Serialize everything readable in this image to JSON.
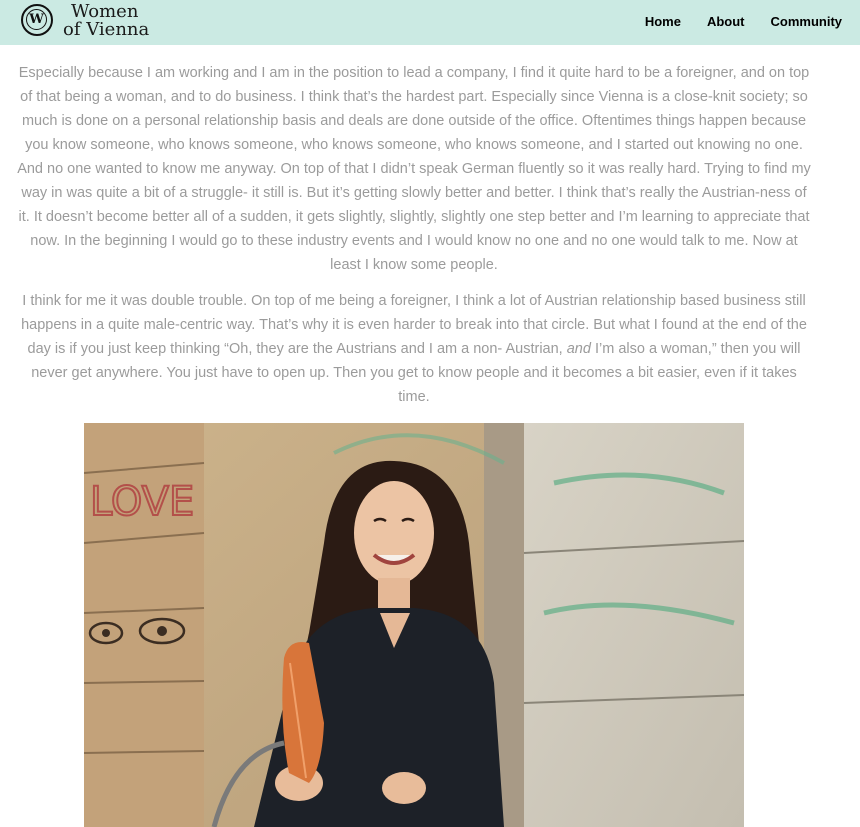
{
  "header": {
    "logo_letter": "W",
    "brand_line1": "Women",
    "brand_line2": "of Vienna",
    "nav": [
      {
        "label": "Home"
      },
      {
        "label": "About"
      },
      {
        "label": "Community"
      }
    ]
  },
  "article": {
    "p1": "Especially because I am working and I am in the position to lead a company, I find it quite hard to be a foreigner, and on top of that being a woman, and to do business. I think that’s the hardest part. Especially since Vienna is a close-knit society; so much is done on a personal relationship basis and deals are done outside of the office. Oftentimes things happen because you know someone, who knows someone, who knows someone, who knows someone, and I started out knowing no one. And no one wanted to know me anyway. On top of that I didn’t speak German fluently so it was really hard. Trying to find my way in was quite a bit of a struggle- it still is. But it’s getting slowly better and better. I think that’s really the Austrian-ness of it. It doesn’t become better all of a sudden, it gets slightly, slightly, slightly one step better and I’m learning to appreciate that now. In the beginning I would go to these industry events and I would know no one and no one would talk to me. Now at least I know some people.",
    "p2_before": "I think for me it was double trouble. On top of me being a foreigner, I think a lot of Austrian relationship based business still happens in a quite male-centric way. That’s why it is even harder to break into that circle. But what I found at the end of the day is if you just keep thinking “Oh, they are the Austrians and I am a non- Austrian, ",
    "p2_em": "and",
    "p2_after": " I’m also a woman,” then you will never get anywhere. You just have to open up. Then you get to know people and it becomes a bit easier, even if it takes time.",
    "wall_text": "LOVE"
  },
  "colors": {
    "header_bg": "#cbeae3",
    "body_text": "#9b9b9b"
  }
}
